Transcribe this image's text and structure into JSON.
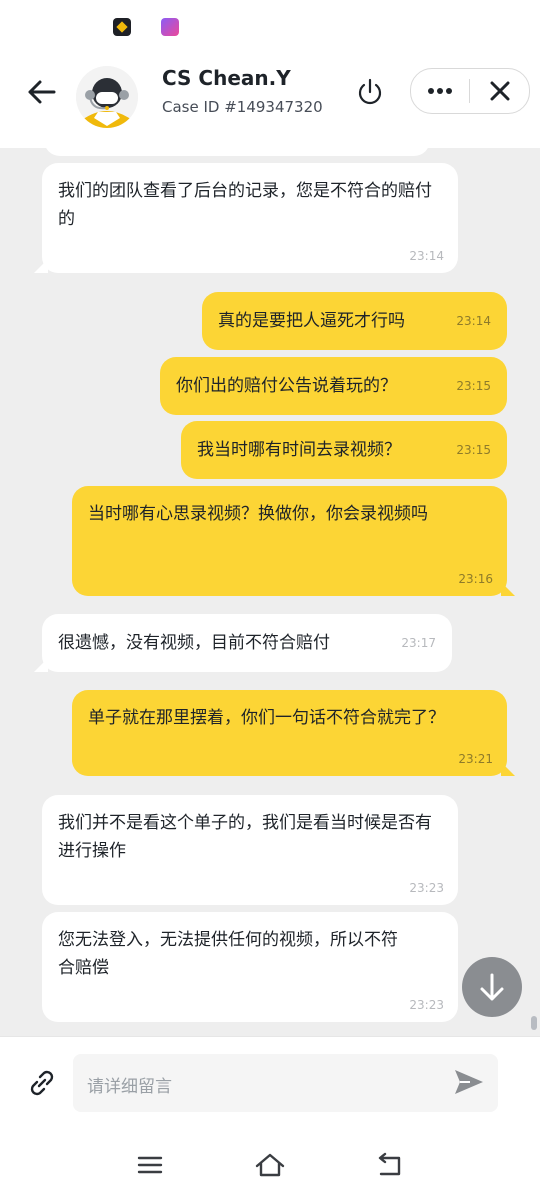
{
  "header": {
    "agent_name": "CS Chean.Y",
    "case_id": "Case ID #149347320"
  },
  "messages": [
    {
      "side": "in",
      "text": "我们的团队查看了后台的记录，您是不符合的赔付的",
      "time": "23:14"
    },
    {
      "side": "out",
      "text": "真的是要把人逼死才行吗",
      "time": "23:14"
    },
    {
      "side": "out",
      "text": "你们出的赔付公告说着玩的？",
      "time": "23:15"
    },
    {
      "side": "out",
      "text": "我当时哪有时间去录视频？",
      "time": "23:15"
    },
    {
      "side": "out",
      "text": "当时哪有心思录视频？换做你，你会录视频吗",
      "time": "23:16"
    },
    {
      "side": "in",
      "text": "很遗憾，没有视频，目前不符合赔付",
      "time": "23:17"
    },
    {
      "side": "out",
      "text": "单子就在那里摆着，你们一句话不符合就完了？",
      "time": "23:21"
    },
    {
      "side": "in",
      "text": "我们并不是看这个单子的，我们是看当时候是否有进行操作",
      "time": "23:23"
    },
    {
      "side": "in",
      "text": "您无法登入，无法提供任何的视频，所以不符合赔偿",
      "time": "23:23"
    }
  ],
  "composer": {
    "placeholder": "请详细留言"
  },
  "colors": {
    "accent": "#fcd535",
    "chat_bg": "#eeeeee",
    "incoming_bubble": "#ffffff"
  },
  "icons": [
    "back-arrow-icon",
    "power-icon",
    "more-icon",
    "close-icon",
    "attach-link-icon",
    "send-icon",
    "scroll-down-arrow-icon",
    "nav-menu-icon",
    "nav-home-icon",
    "nav-back-icon"
  ]
}
